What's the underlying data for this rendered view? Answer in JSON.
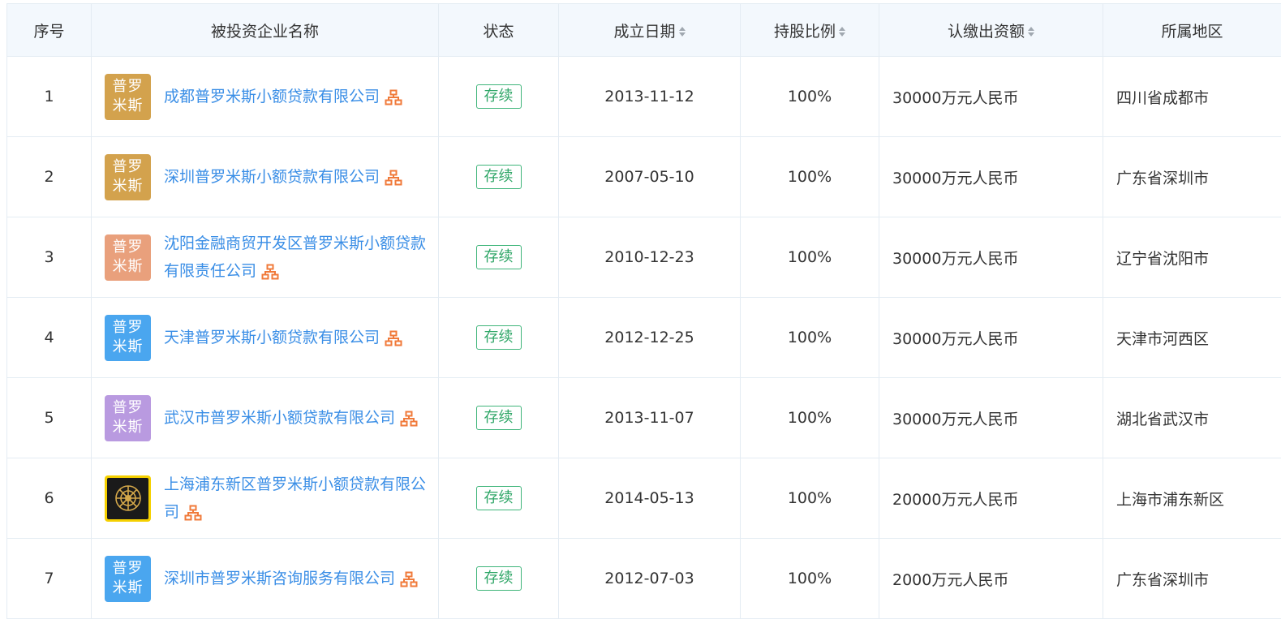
{
  "headers": {
    "index": "序号",
    "company": "被投资企业名称",
    "status": "状态",
    "date": "成立日期",
    "ratio": "持股比例",
    "capital": "认缴出资额",
    "region": "所属地区"
  },
  "rows": [
    {
      "index": "1",
      "logo": {
        "line1": "普罗",
        "line2": "米斯",
        "color": "#d3a24d"
      },
      "name": "成都普罗米斯小额贷款有限公司",
      "status": "存续",
      "date": "2013-11-12",
      "ratio": "100%",
      "capital": "30000万元人民币",
      "region": "四川省成都市"
    },
    {
      "index": "2",
      "logo": {
        "line1": "普罗",
        "line2": "米斯",
        "color": "#d3a24d"
      },
      "name": "深圳普罗米斯小额贷款有限公司",
      "status": "存续",
      "date": "2007-05-10",
      "ratio": "100%",
      "capital": "30000万元人民币",
      "region": "广东省深圳市"
    },
    {
      "index": "3",
      "logo": {
        "line1": "普罗",
        "line2": "米斯",
        "color": "#e9a07c"
      },
      "name": "沈阳金融商贸开发区普罗米斯小额贷款有限责任公司",
      "status": "存续",
      "date": "2010-12-23",
      "ratio": "100%",
      "capital": "30000万元人民币",
      "region": "辽宁省沈阳市"
    },
    {
      "index": "4",
      "logo": {
        "line1": "普罗",
        "line2": "米斯",
        "color": "#4aa6ef"
      },
      "name": "天津普罗米斯小额贷款有限公司",
      "status": "存续",
      "date": "2012-12-25",
      "ratio": "100%",
      "capital": "30000万元人民币",
      "region": "天津市河西区"
    },
    {
      "index": "5",
      "logo": {
        "line1": "普罗",
        "line2": "米斯",
        "color": "#b99ae0"
      },
      "name": "武汉市普罗米斯小额贷款有限公司",
      "status": "存续",
      "date": "2013-11-07",
      "ratio": "100%",
      "capital": "30000万元人民币",
      "region": "湖北省武汉市"
    },
    {
      "index": "6",
      "logo": {
        "line1": "",
        "line2": "",
        "color": "#f5d000"
      },
      "name": "上海浦东新区普罗米斯小额贷款有限公司",
      "status": "存续",
      "date": "2014-05-13",
      "ratio": "100%",
      "capital": "20000万元人民币",
      "region": "上海市浦东新区"
    },
    {
      "index": "7",
      "logo": {
        "line1": "普罗",
        "line2": "米斯",
        "color": "#4aa6ef"
      },
      "name": "深圳市普罗米斯咨询服务有限公司",
      "status": "存续",
      "date": "2012-07-03",
      "ratio": "100%",
      "capital": "2000万元人民币",
      "region": "广东省深圳市"
    }
  ],
  "colors": {
    "link": "#3a8ee6",
    "status": "#2fa667",
    "header_bg": "#f3f8fd",
    "tree_icon": "#f07a3a"
  }
}
